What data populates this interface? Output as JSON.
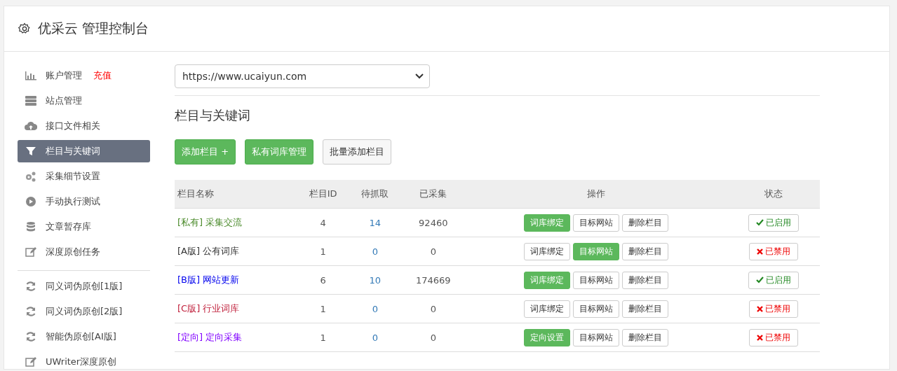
{
  "header": {
    "title": "优采云 管理控制台"
  },
  "sidebar": {
    "items": [
      {
        "label": "账户管理",
        "badge": "充值",
        "selected": false
      },
      {
        "label": "站点管理",
        "selected": false
      },
      {
        "label": "接口文件相关",
        "selected": false
      },
      {
        "label": "栏目与关键词",
        "selected": true
      },
      {
        "label": "采集细节设置",
        "selected": false
      },
      {
        "label": "手动执行测试",
        "selected": false
      },
      {
        "label": "文章暂存库",
        "selected": false
      },
      {
        "label": "深度原创任务",
        "selected": false
      }
    ],
    "tools": [
      {
        "label": "同义词伪原创[1版]"
      },
      {
        "label": "同义词伪原创[2版]"
      },
      {
        "label": "智能伪原创[AI版]"
      },
      {
        "label": "UWriter深度原创"
      }
    ]
  },
  "site_select": {
    "value": "https://www.ucaiyun.com"
  },
  "section_title": "栏目与关键词",
  "buttons": [
    {
      "label": "添加栏目 +",
      "kind": "primary"
    },
    {
      "label": "私有词库管理",
      "kind": "primary"
    },
    {
      "label": "批量添加栏目",
      "kind": "default"
    }
  ],
  "table": {
    "columns": [
      "栏目名称",
      "栏目ID",
      "待抓取",
      "已采集",
      "操作",
      "状态"
    ],
    "rows": [
      {
        "tag": "[私有]",
        "name": "采集交流",
        "color": "#4a8a2a",
        "id": "4",
        "pending": "14",
        "collected": "92460",
        "actions": [
          {
            "label": "词库绑定",
            "primary": true
          },
          {
            "label": "目标网站",
            "primary": false
          },
          {
            "label": "删除栏目",
            "primary": false
          }
        ],
        "status": {
          "label": "已启用",
          "enabled": true
        }
      },
      {
        "tag": "[A版]",
        "name": "公有词库",
        "color": "#333333",
        "id": "1",
        "pending": "0",
        "collected": "0",
        "actions": [
          {
            "label": "词库绑定",
            "primary": false
          },
          {
            "label": "目标网站",
            "primary": true
          },
          {
            "label": "删除栏目",
            "primary": false
          }
        ],
        "status": {
          "label": "已禁用",
          "enabled": false
        }
      },
      {
        "tag": "[B版]",
        "name": "网站更新",
        "color": "#0000ee",
        "id": "6",
        "pending": "10",
        "collected": "174669",
        "actions": [
          {
            "label": "词库绑定",
            "primary": true
          },
          {
            "label": "目标网站",
            "primary": false
          },
          {
            "label": "删除栏目",
            "primary": false
          }
        ],
        "status": {
          "label": "已启用",
          "enabled": true
        }
      },
      {
        "tag": "[C版]",
        "name": "行业词库",
        "color": "#c0203c",
        "id": "1",
        "pending": "0",
        "collected": "0",
        "actions": [
          {
            "label": "词库绑定",
            "primary": false
          },
          {
            "label": "目标网站",
            "primary": false
          },
          {
            "label": "删除栏目",
            "primary": false
          }
        ],
        "status": {
          "label": "已禁用",
          "enabled": false
        }
      },
      {
        "tag": "[定向]",
        "name": "定向采集",
        "color": "#8000ff",
        "id": "1",
        "pending": "0",
        "collected": "0",
        "actions": [
          {
            "label": "定向设置",
            "primary": true
          },
          {
            "label": "目标网站",
            "primary": false
          },
          {
            "label": "删除栏目",
            "primary": false
          }
        ],
        "status": {
          "label": "已禁用",
          "enabled": false
        }
      }
    ]
  }
}
